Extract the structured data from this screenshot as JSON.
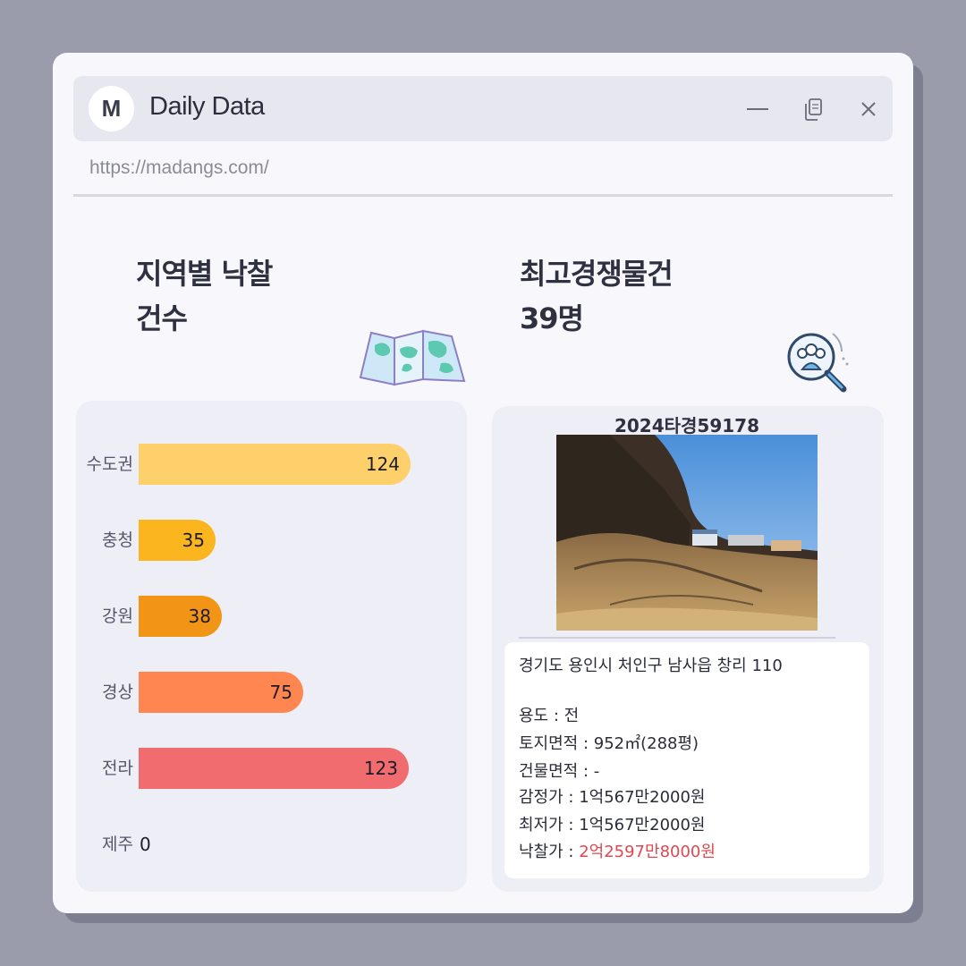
{
  "window": {
    "logo_letter": "M",
    "app_title": "Daily Data",
    "url": "https://madangs.com/",
    "controls": [
      "minimize-icon",
      "copy-icon",
      "close-icon"
    ]
  },
  "left_section": {
    "title_line1": "지역별 낙찰",
    "title_line2": "건수",
    "icon": "map-icon"
  },
  "right_section": {
    "title_line1": "최고경쟁물건",
    "title_line2": "39명",
    "icon": "people-search-icon"
  },
  "chart_data": {
    "type": "bar",
    "orientation": "horizontal",
    "categories": [
      "수도권",
      "충청",
      "강원",
      "경상",
      "전라",
      "제주"
    ],
    "values": [
      124,
      35,
      38,
      75,
      123,
      0
    ],
    "colors": [
      "#fdd06b",
      "#fbb61f",
      "#f29415",
      "#ff8650",
      "#f06c6e",
      "#f06c6e"
    ],
    "xlim": [
      0,
      124
    ]
  },
  "property": {
    "case_number": "2024타경59178",
    "address": "경기도 용인시 처인구 남사읍 창리 110",
    "rows": [
      {
        "label": "용도 : ",
        "value": "전"
      },
      {
        "label": "토지면적 : ",
        "value": "952㎡(288평)"
      },
      {
        "label": "건물면적 : ",
        "value": "-"
      },
      {
        "label": "감정가 : ",
        "value": "1억567만2000원"
      },
      {
        "label": "최저가 : ",
        "value": "1억567만2000원"
      },
      {
        "label": "낙찰가 : ",
        "value": "2억2597만8000원"
      }
    ],
    "highlight_color": "#e0484f"
  }
}
